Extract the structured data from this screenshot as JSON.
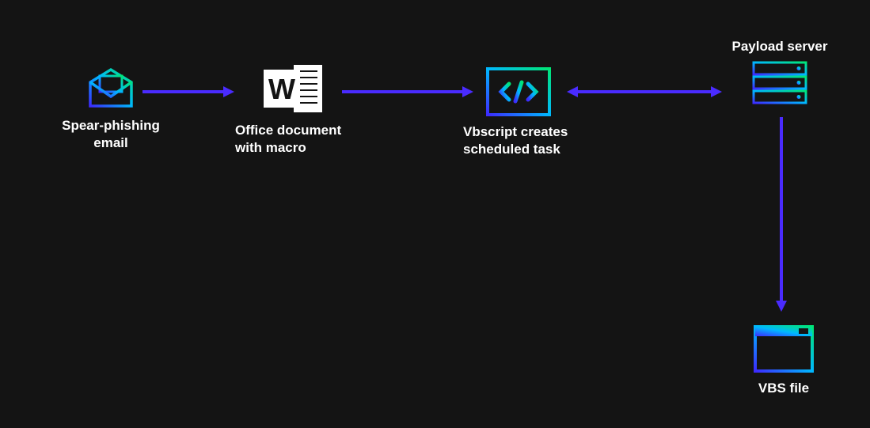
{
  "nodes": {
    "email": {
      "label": "Spear-phishing email"
    },
    "office": {
      "label": "Office document\nwith macro"
    },
    "vbscript": {
      "label": "Vbscript creates\nscheduled task"
    },
    "server": {
      "label": "Payload server"
    },
    "vbsfile": {
      "label": "VBS file"
    }
  },
  "colors": {
    "grad_start": "#3d2bff",
    "grad_mid": "#00b8ff",
    "grad_end": "#00e676",
    "arrow": "#4a2bff"
  }
}
